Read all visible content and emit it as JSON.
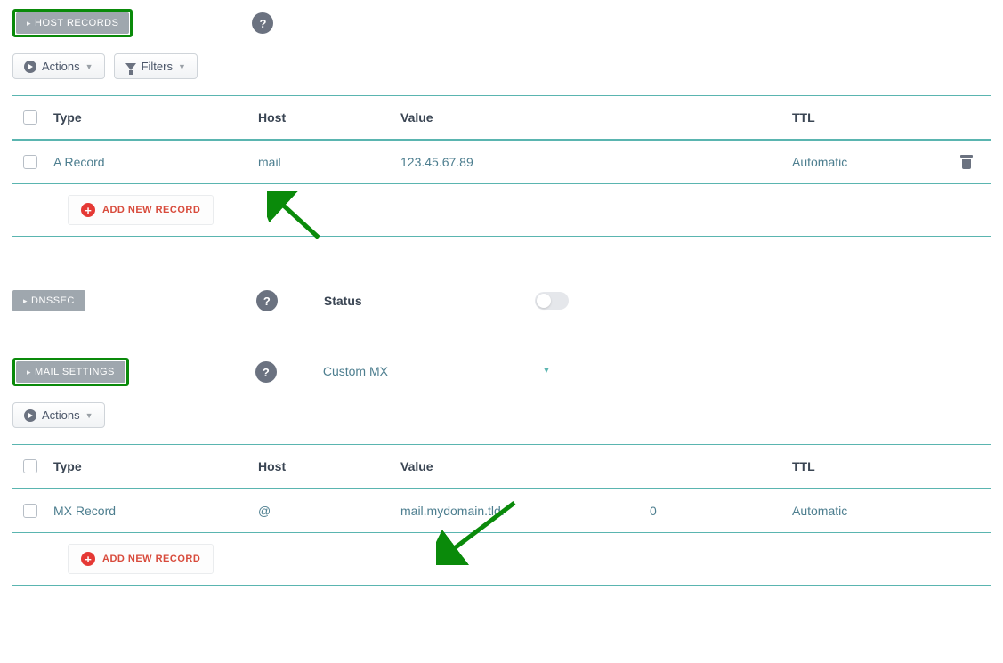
{
  "hostRecords": {
    "tabLabel": "HOST RECORDS",
    "actionsLabel": "Actions",
    "filtersLabel": "Filters",
    "columns": {
      "type": "Type",
      "host": "Host",
      "value": "Value",
      "ttl": "TTL"
    },
    "rows": [
      {
        "type": "A Record",
        "host": "mail",
        "value": "123.45.67.89",
        "ttl": "Automatic"
      }
    ],
    "addNewLabel": "ADD NEW RECORD"
  },
  "dnssec": {
    "tabLabel": "DNSSEC",
    "statusLabel": "Status",
    "enabled": false
  },
  "mailSettings": {
    "tabLabel": "MAIL SETTINGS",
    "selected": "Custom MX",
    "actionsLabel": "Actions",
    "columns": {
      "type": "Type",
      "host": "Host",
      "value": "Value",
      "ttl": "TTL"
    },
    "rows": [
      {
        "type": "MX Record",
        "host": "@",
        "value": "mail.mydomain.tld.",
        "priority": "0",
        "ttl": "Automatic"
      }
    ],
    "addNewLabel": "ADD NEW RECORD"
  },
  "colors": {
    "accentTeal": "#5ab5b0",
    "addRed": "#e53935",
    "highlightGreen": "#0a8a0a"
  }
}
